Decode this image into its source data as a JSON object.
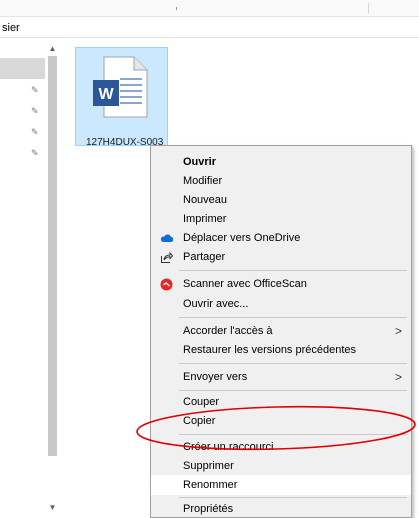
{
  "address": {
    "text": "sier"
  },
  "file": {
    "name": "127H4DUX-S003",
    "icon": "word-document-icon",
    "icon_letter": "W",
    "accent": "#2b579a"
  },
  "menu": {
    "items": [
      {
        "label": "Ouvrir",
        "bold": true
      },
      {
        "label": "Modifier"
      },
      {
        "label": "Nouveau"
      },
      {
        "label": "Imprimer"
      },
      {
        "label": "Déplacer vers OneDrive",
        "icon": "onedrive-cloud-icon"
      },
      {
        "label": "Partager",
        "icon": "share-icon"
      },
      {
        "label": "Scanner avec OfficeScan",
        "icon": "officescan-icon"
      },
      {
        "label": "Ouvrir avec..."
      },
      {
        "label": "Accorder l'accès à",
        "submenu": true
      },
      {
        "label": "Restaurer les versions précédentes"
      },
      {
        "label": "Envoyer vers",
        "submenu": true
      },
      {
        "label": "Couper"
      },
      {
        "label": "Copier"
      },
      {
        "label": "Créer un raccourci"
      },
      {
        "label": "Supprimer"
      },
      {
        "label": "Renommer",
        "highlighted": true
      },
      {
        "label": "Propriétés"
      }
    ]
  },
  "annotation": {
    "shape": "ellipse",
    "color": "#e00000",
    "target": "Copier"
  }
}
